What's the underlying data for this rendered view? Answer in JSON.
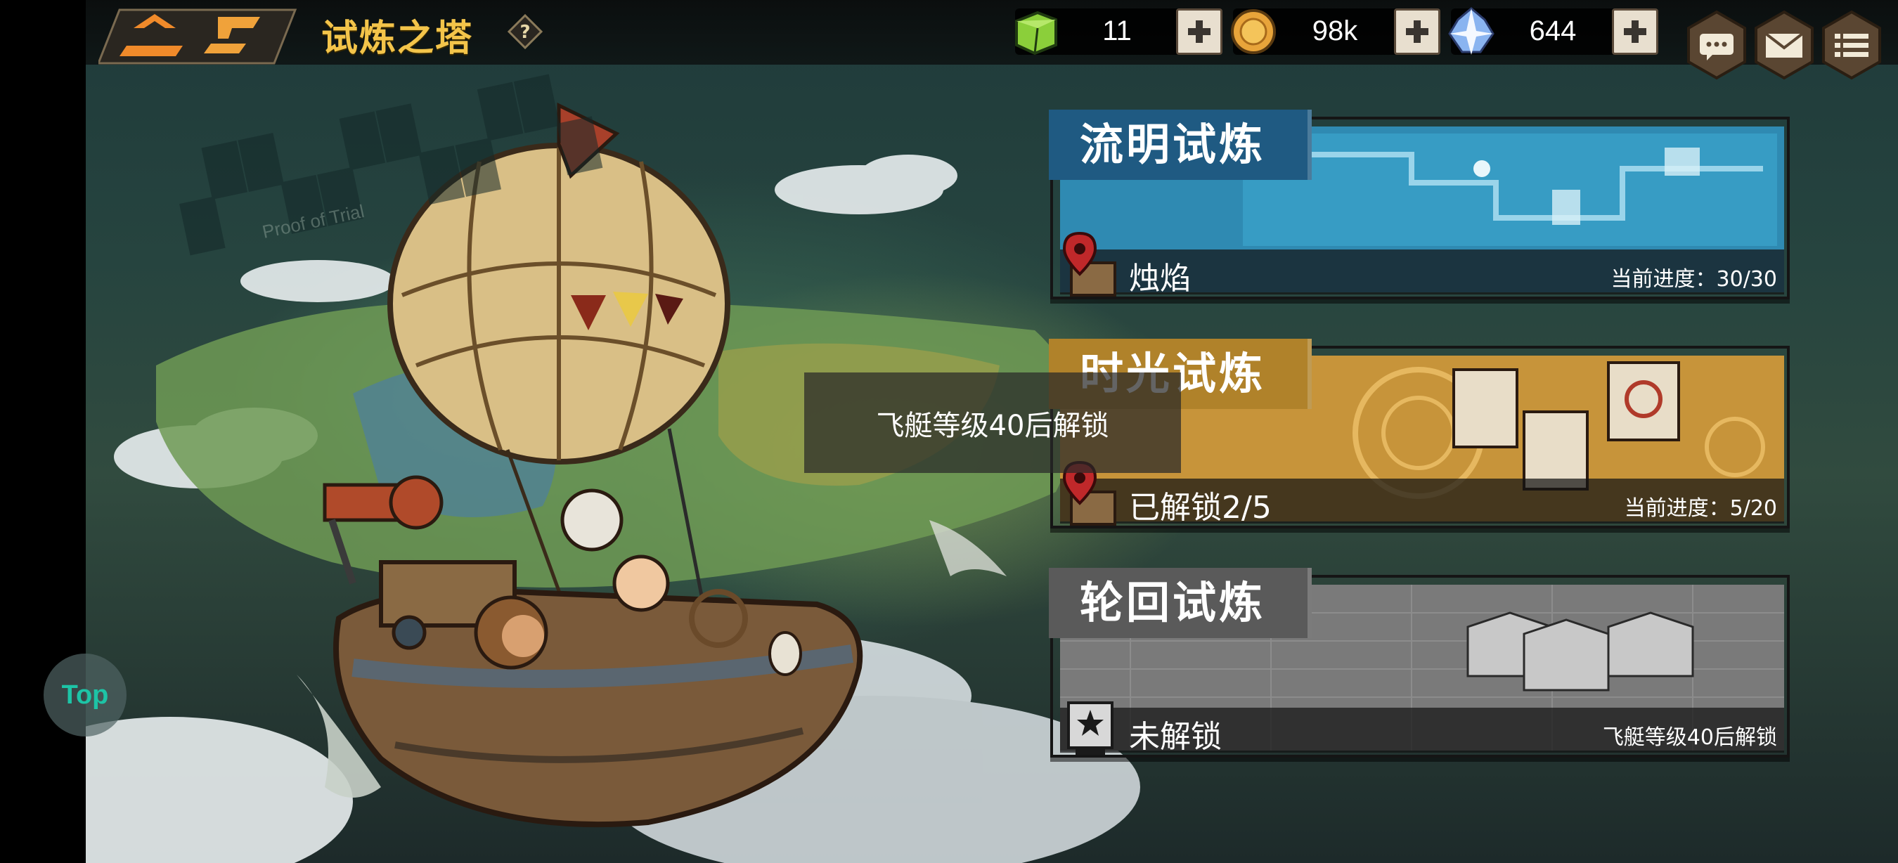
{
  "header": {
    "title": "试炼之塔",
    "help_icon": "question-icon",
    "resources": [
      {
        "name": "stamina",
        "icon": "green-cube-icon",
        "value": "11"
      },
      {
        "name": "gold",
        "icon": "coin-icon",
        "value": "98k"
      },
      {
        "name": "crystal",
        "icon": "crystal-icon",
        "value": "644"
      }
    ],
    "menu_icons": [
      "chat-icon",
      "mail-icon",
      "menu-icon"
    ]
  },
  "background": {
    "watermark_sub": "Proof of Trial"
  },
  "trials": [
    {
      "title": "流明试炼",
      "subtitle": "烛焰",
      "progress": "当前进度：30/30",
      "state": "unlocked",
      "color": "#1f6c96"
    },
    {
      "title": "时光试炼",
      "subtitle": "已解锁2/5",
      "progress": "当前进度：5/20",
      "state": "unlocked",
      "color": "#c0902f"
    },
    {
      "title": "轮回试炼",
      "subtitle": "未解锁",
      "progress": "飞艇等级40后解锁",
      "state": "locked",
      "color": "#6b6b6b"
    }
  ],
  "tooltip": "飞艇等级40后解锁",
  "floating_button": "Top",
  "colors": {
    "title_gold": "#f3c44a",
    "trial_blue": "#1f6c96",
    "trial_gold": "#c0902f",
    "trial_gray": "#6b6b6b"
  }
}
